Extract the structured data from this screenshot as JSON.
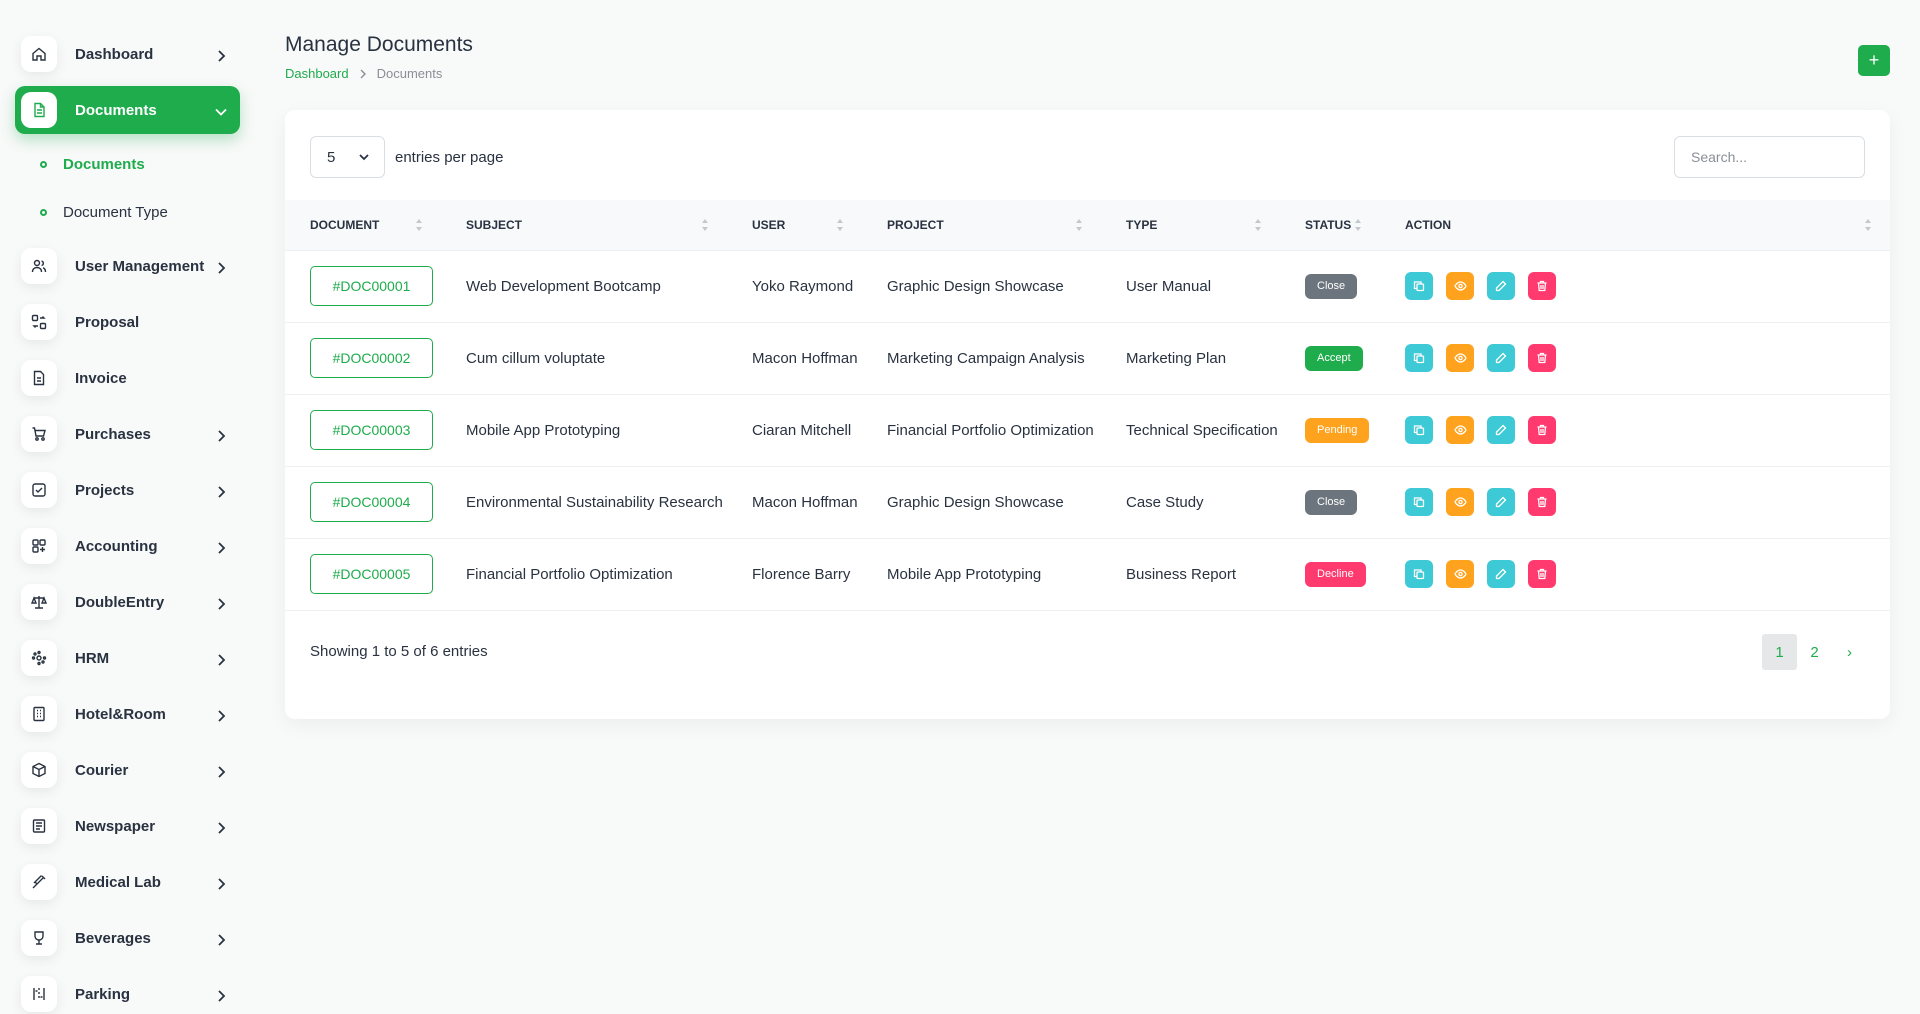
{
  "sidebar": {
    "items": [
      {
        "label": "Dashboard",
        "icon": "home-icon"
      },
      {
        "label": "Documents",
        "icon": "file-icon"
      },
      {
        "label": "User Management",
        "icon": "users-icon"
      },
      {
        "label": "Proposal",
        "icon": "proposal-icon"
      },
      {
        "label": "Invoice",
        "icon": "invoice-icon"
      },
      {
        "label": "Purchases",
        "icon": "cart-icon"
      },
      {
        "label": "Projects",
        "icon": "checkbox-icon"
      },
      {
        "label": "Accounting",
        "icon": "grid-icon"
      },
      {
        "label": "DoubleEntry",
        "icon": "scale-icon"
      },
      {
        "label": "HRM",
        "icon": "hrm-icon"
      },
      {
        "label": "Hotel&Room",
        "icon": "building-icon"
      },
      {
        "label": "Courier",
        "icon": "box-icon"
      },
      {
        "label": "Newspaper",
        "icon": "newspaper-icon"
      },
      {
        "label": "Medical Lab",
        "icon": "syringe-icon"
      },
      {
        "label": "Beverages",
        "icon": "cup-icon"
      },
      {
        "label": "Parking",
        "icon": "parking-icon"
      }
    ],
    "sub_items": [
      {
        "label": "Documents"
      },
      {
        "label": "Document Type"
      }
    ]
  },
  "header": {
    "title": "Manage Documents",
    "breadcrumb": {
      "home": "Dashboard",
      "current": "Documents"
    },
    "add_label": "+"
  },
  "controls": {
    "entries_value": "5",
    "entries_label": "entries per page",
    "search_placeholder": "Search..."
  },
  "table": {
    "columns": [
      "Document",
      "Subject",
      "User",
      "Project",
      "Type",
      "Status",
      "Action"
    ],
    "rows": [
      {
        "document": "#DOC00001",
        "subject": "Web Development Bootcamp",
        "user": "Yoko Raymond",
        "project": "Graphic Design Showcase",
        "type": "User Manual",
        "status": "Close"
      },
      {
        "document": "#DOC00002",
        "subject": "Cum cillum voluptate",
        "user": "Macon Hoffman",
        "project": "Marketing Campaign Analysis",
        "type": "Marketing Plan",
        "status": "Accept"
      },
      {
        "document": "#DOC00003",
        "subject": "Mobile App Prototyping",
        "user": "Ciaran Mitchell",
        "project": "Financial Portfolio Optimization",
        "type": "Technical Specification",
        "status": "Pending"
      },
      {
        "document": "#DOC00004",
        "subject": "Environmental Sustainability Research",
        "user": "Macon Hoffman",
        "project": "Graphic Design Showcase",
        "type": "Case Study",
        "status": "Close"
      },
      {
        "document": "#DOC00005",
        "subject": "Financial Portfolio Optimization",
        "user": "Florence Barry",
        "project": "Mobile App Prototyping",
        "type": "Business Report",
        "status": "Decline"
      }
    ]
  },
  "footer": {
    "showing": "Showing 1 to 5 of 6 entries",
    "pages": [
      "1",
      "2"
    ],
    "next": "›"
  },
  "colors": {
    "brand": "#1fac4d",
    "status_close": "#6c757d",
    "status_accept": "#1fac4d",
    "status_pending": "#ffa21d",
    "status_decline": "#ff3a6e",
    "action_copy": "#3ec9d6",
    "action_view": "#ffa21d",
    "action_edit": "#3ec9d6",
    "action_delete": "#ff3a6e"
  }
}
